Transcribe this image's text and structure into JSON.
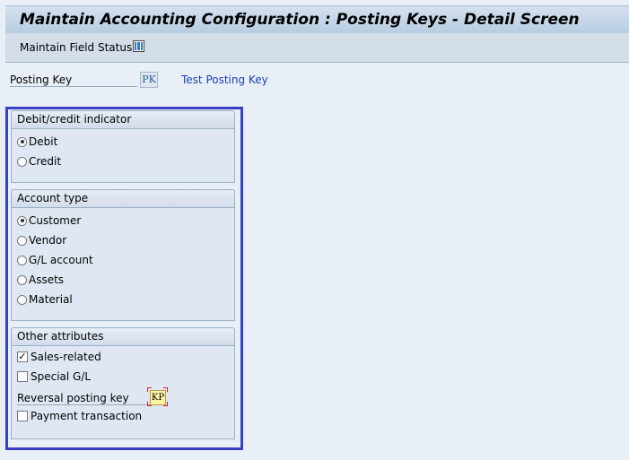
{
  "title": "Maintain Accounting Configuration : Posting Keys - Detail Screen",
  "toolbar": {
    "maintain_field_status": "Maintain Field Status",
    "icon": "table-icon"
  },
  "posting_key": {
    "label": "Posting Key",
    "value": "PK",
    "link": "Test Posting Key"
  },
  "debit_credit": {
    "header": "Debit/credit indicator",
    "options": [
      {
        "label": "Debit",
        "selected": true
      },
      {
        "label": "Credit",
        "selected": false
      }
    ]
  },
  "account_type": {
    "header": "Account type",
    "options": [
      {
        "label": "Customer",
        "selected": true
      },
      {
        "label": "Vendor",
        "selected": false
      },
      {
        "label": "G/L account",
        "selected": false
      },
      {
        "label": "Assets",
        "selected": false
      },
      {
        "label": "Material",
        "selected": false
      }
    ]
  },
  "other": {
    "header": "Other attributes",
    "sales_related": {
      "label": "Sales-related",
      "checked": true
    },
    "special_gl": {
      "label": "Special G/L",
      "checked": false
    },
    "reversal_label": "Reversal posting key",
    "reversal_value": "KP",
    "payment": {
      "label": "Payment transaction",
      "checked": false
    }
  }
}
